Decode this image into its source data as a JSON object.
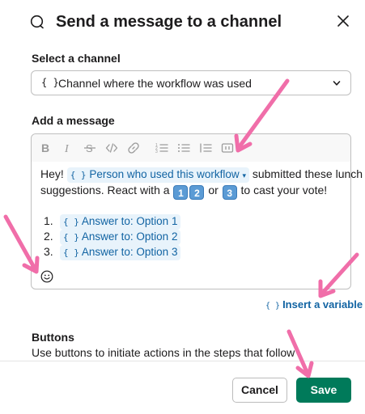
{
  "modal": {
    "title": "Send a message to a channel",
    "close_icon": "close-icon"
  },
  "channel": {
    "label": "Select a channel",
    "var_icon": "{ }",
    "value": "Channel where the workflow was used"
  },
  "message": {
    "label": "Add a message",
    "toolbar": [
      "bold",
      "italic",
      "strikethrough",
      "code",
      "link",
      "ordered-list",
      "bulleted-list",
      "checklist",
      "code-block"
    ],
    "line1_prefix": "Hey!",
    "variable_pill": "Person who used this workflow",
    "line1_suffix": "submitted these lunch",
    "line2_prefix": "suggestions. React with a",
    "emoji_1": "1",
    "emoji_2": "2",
    "or": "or",
    "emoji_3": "3",
    "line2_suffix": "to cast your vote!",
    "list": [
      {
        "num": "1.",
        "value": "Answer to: Option 1"
      },
      {
        "num": "2.",
        "value": "Answer to: Option 2"
      },
      {
        "num": "3.",
        "value": "Answer to: Option 3"
      }
    ],
    "braces": "{ }"
  },
  "insert_variable": "Insert a variable",
  "buttons_section": {
    "title": "Buttons",
    "description": "Use buttons to initiate actions in the steps that follow"
  },
  "footer": {
    "cancel": "Cancel",
    "save": "Save",
    "save_color": "#007a5a"
  },
  "annotation_color": "#f06ea9"
}
